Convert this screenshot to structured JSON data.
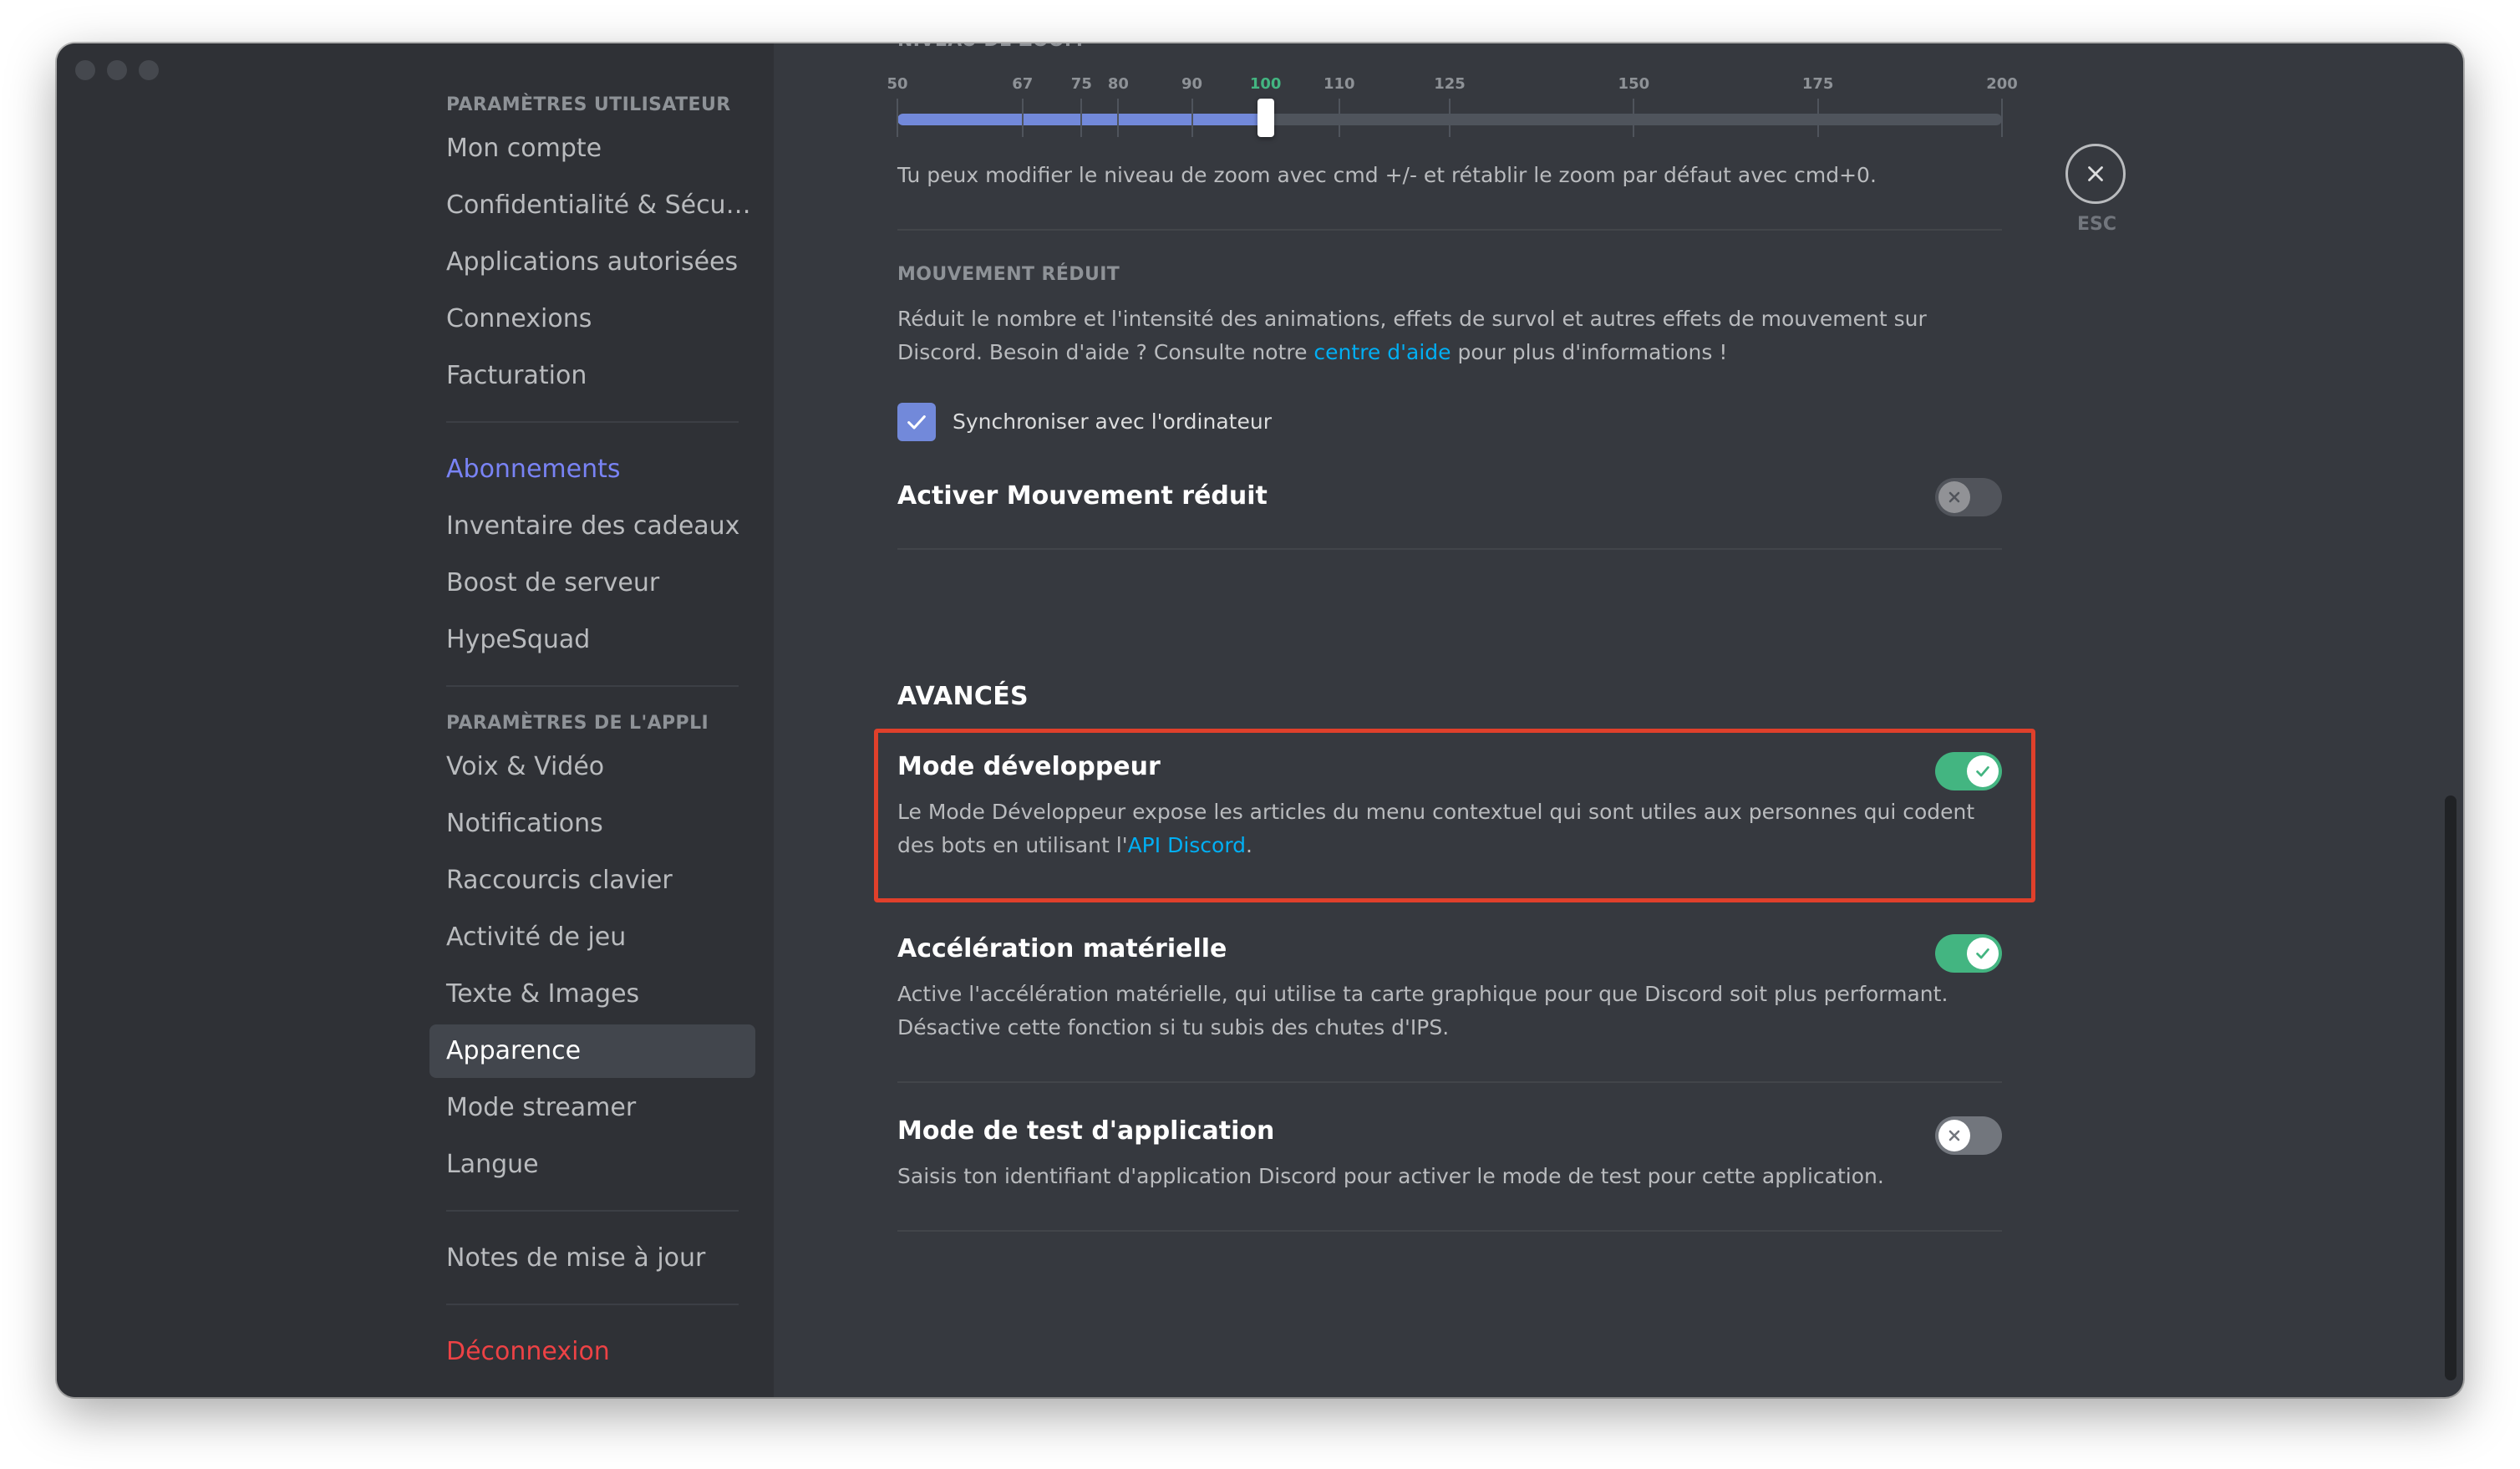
{
  "sidebar": {
    "user_settings_header": "PARAMÈTRES UTILISATEUR",
    "user_items": [
      {
        "label": "Mon compte"
      },
      {
        "label": "Confidentialité & Sécuri…"
      },
      {
        "label": "Applications autorisées"
      },
      {
        "label": "Connexions"
      },
      {
        "label": "Facturation"
      }
    ],
    "billing_items": [
      {
        "label": "Abonnements"
      },
      {
        "label": "Inventaire des cadeaux"
      },
      {
        "label": "Boost de serveur"
      },
      {
        "label": "HypeSquad"
      }
    ],
    "app_settings_header": "PARAMÈTRES DE L'APPLI",
    "app_items": [
      {
        "label": "Voix & Vidéo"
      },
      {
        "label": "Notifications"
      },
      {
        "label": "Raccourcis clavier"
      },
      {
        "label": "Activité de jeu"
      },
      {
        "label": "Texte & Images"
      },
      {
        "label": "Apparence"
      },
      {
        "label": "Mode streamer"
      },
      {
        "label": "Langue"
      }
    ],
    "changelog": "Notes de mise à jour",
    "logout": "Déconnexion",
    "active_item": "Apparence"
  },
  "zoom": {
    "header": "NIVEAU DE ZOOM",
    "ticks": [
      "50",
      "67",
      "75",
      "80",
      "90",
      "100",
      "110",
      "125",
      "150",
      "175",
      "200"
    ],
    "value": "100",
    "hint": "Tu peux modifier le niveau de zoom avec cmd +/- et rétablir le zoom par défaut avec cmd+0."
  },
  "reduced_motion": {
    "header": "MOUVEMENT RÉDUIT",
    "desc_before": "Réduit le nombre et l'intensité des animations, effets de survol et autres effets de mouvement sur Discord. Besoin d'aide ? Consulte notre ",
    "desc_link": "centre d'aide",
    "desc_after": " pour plus d'informations !",
    "sync_label": "Synchroniser avec l'ordinateur",
    "sync_checked": true,
    "enable_label": "Activer Mouvement réduit",
    "enable_on": false
  },
  "advanced": {
    "title": "AVANCÉS",
    "developer": {
      "title": "Mode développeur",
      "desc_before": "Le Mode Développeur expose les articles du menu contextuel qui sont utiles aux personnes qui codent des bots en utilisant l'",
      "desc_link": "API Discord",
      "desc_after": ".",
      "on": true
    },
    "hardware": {
      "title": "Accélération matérielle",
      "desc": "Active l'accélération matérielle, qui utilise ta carte graphique pour que Discord soit plus performant. Désactive cette fonction si tu subis des chutes d'IPS.",
      "on": true
    },
    "test_mode": {
      "title": "Mode de test d'application",
      "desc": "Saisis ton identifiant d'application Discord pour activer le mode de test pour cette application.",
      "on": false
    }
  },
  "close": {
    "label": "ESC"
  },
  "colors": {
    "background": "#36393f",
    "sidebar": "#2f3136",
    "accent": "#7289da",
    "toggle_on": "#43b581",
    "link": "#00aff4",
    "danger": "#ed4245",
    "highlight": "#e0402b"
  }
}
